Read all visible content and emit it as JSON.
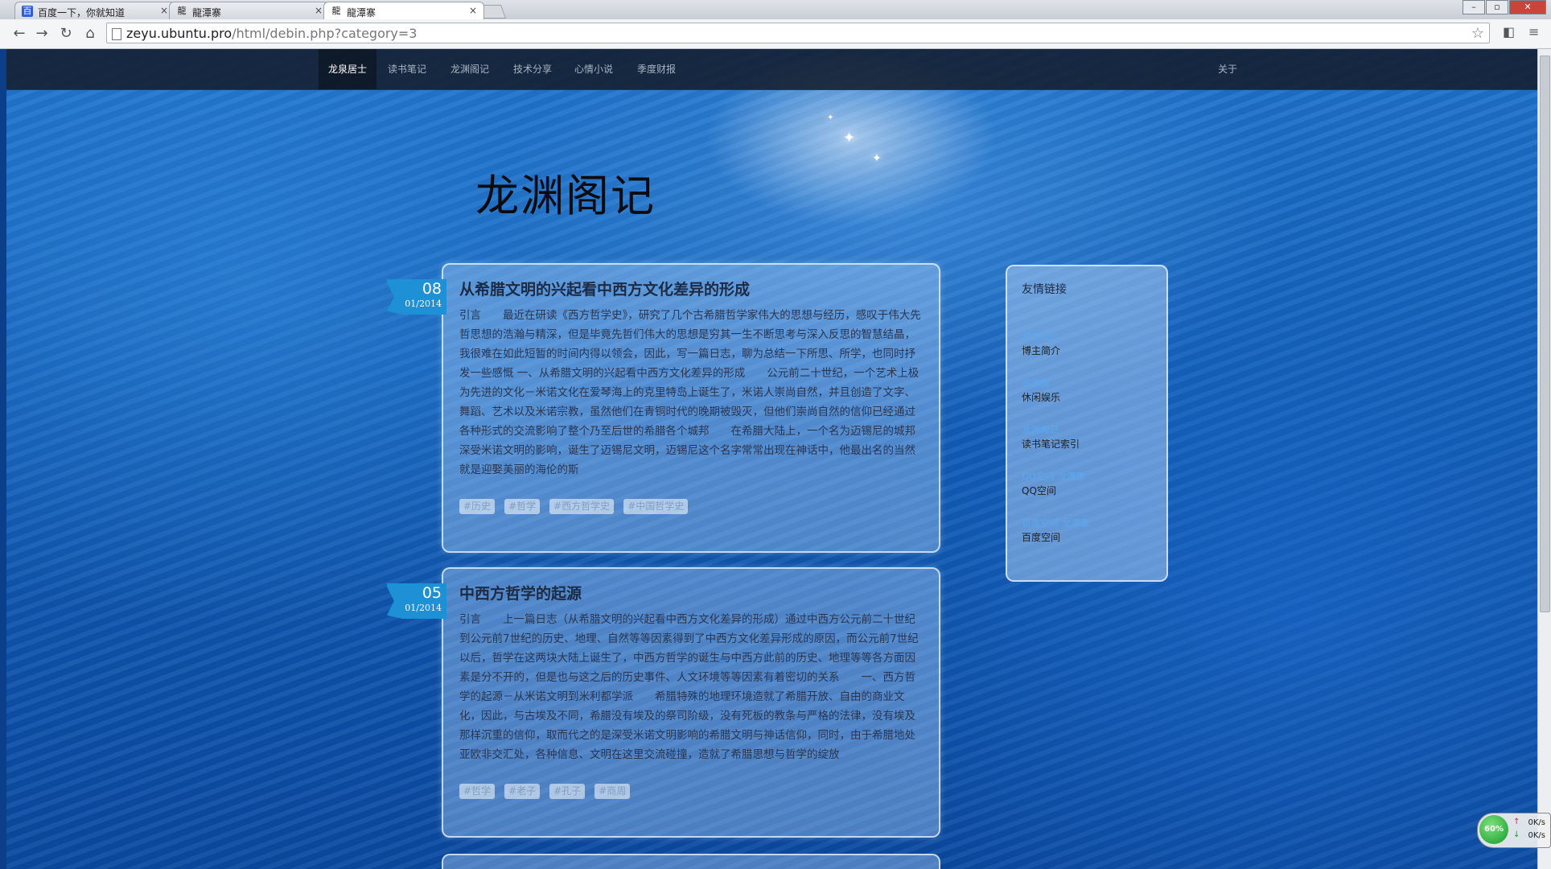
{
  "browser": {
    "tabs": [
      {
        "title": "百度一下，你就知道",
        "icon": "baidu-favicon-icon"
      },
      {
        "title": "龍潭寨",
        "icon": "dragon-favicon-icon"
      },
      {
        "title": "龍潭寨",
        "icon": "dragon-favicon-icon",
        "active": true
      }
    ],
    "close_glyph": "×",
    "url_host": "zeyu.ubuntu.pro",
    "url_path": "/html/debin.php?category=3"
  },
  "nav": {
    "items": [
      "龙泉居士",
      "读书笔记",
      "龙渊阁记",
      "技术分享",
      "心情小说",
      "季度财报"
    ],
    "about": "关于"
  },
  "site_title": "龙渊阁记",
  "posts": [
    {
      "day": "08",
      "month_year": "01/2014",
      "title": "从希腊文明的兴起看中西方文化差异的形成",
      "excerpt": "引言　　最近在研读《西方哲学史》，研究了几个古希腊哲学家伟大的思想与经历，感叹于伟大先哲思想的浩瀚与精深，但是毕竟先哲们伟大的思想是穷其一生不断思考与深入反思的智慧结晶，我很难在如此短暂的时间内得以领会，因此，写一篇日志，聊为总结一下所思、所学，也同时抒发一些感慨 一、从希腊文明的兴起看中西方文化差异的形成　　公元前二十世纪，一个艺术上极为先进的文化－米诺文化在爱琴海上的克里特岛上诞生了，米诺人崇尚自然，并且创造了文字、舞蹈、艺术以及米诺宗教，虽然他们在青铜时代的晚期被毁灭，但他们崇尚自然的信仰已经通过各种形式的交流影响了整个乃至后世的希腊各个城邦　　在希腊大陆上，一个名为迈锡尼的城邦深受米诺文明的影响，诞生了迈锡尼文明，迈锡尼这个名字常常出现在神话中，他最出名的当然就是迎娶美丽的海伦的斯",
      "tags": [
        "#历史",
        "#哲学",
        "#西方哲学史",
        "#中国哲学史"
      ]
    },
    {
      "day": "05",
      "month_year": "01/2014",
      "title": "中西方哲学的起源",
      "excerpt": "引言　　上一篇日志（从希腊文明的兴起看中西方文化差异的形成）通过中西方公元前二十世纪到公元前7世纪的历史、地理、自然等等因素得到了中西方文化差异形成的原因，而公元前7世纪以后，哲学在这两块大陆上诞生了，中西方哲学的诞生与中西方此前的历史、地理等等各方面因素是分不开的，但是也与这之后的历史事件、人文环境等等因素有着密切的关系　　一、西方哲学的起源－从米诺文明到米利都学派　　希腊特殊的地理环境造就了希腊开放、自由的商业文化，因此，与古埃及不同，希腊没有埃及的祭司阶级，没有死板的教条与严格的法律，没有埃及那样沉重的信仰，取而代之的是深受米诺文明影响的希腊文明与神话信仰，同时，由于希腊地处亚欧非交汇处，各种信息、文明在这里交流碰撞，造就了希腊思想与哲学的绽放",
      "tags": [
        "#哲学",
        "#老子",
        "#孔子",
        "#商周"
      ]
    }
  ],
  "sidebar": {
    "title": "友情链接",
    "links": [
      {
        "name": "博主简介",
        "desc": "博主简介"
      },
      {
        "name": "龙渊阁",
        "desc": "休闲娱乐"
      },
      {
        "name": "龙渊阁记",
        "desc": "读书笔记索引"
      },
      {
        "name": "QQ空间 龙潭寨",
        "desc": "QQ空间"
      },
      {
        "name": "百度空间 龙潭寨",
        "desc": "百度空间"
      }
    ]
  },
  "net_monitor": {
    "percent": "60%",
    "up": "0K/s",
    "down": "0K/s"
  },
  "colors": {
    "accent": "#1d90d6",
    "link": "#5aa8f0",
    "navbar": "#141e2d"
  }
}
